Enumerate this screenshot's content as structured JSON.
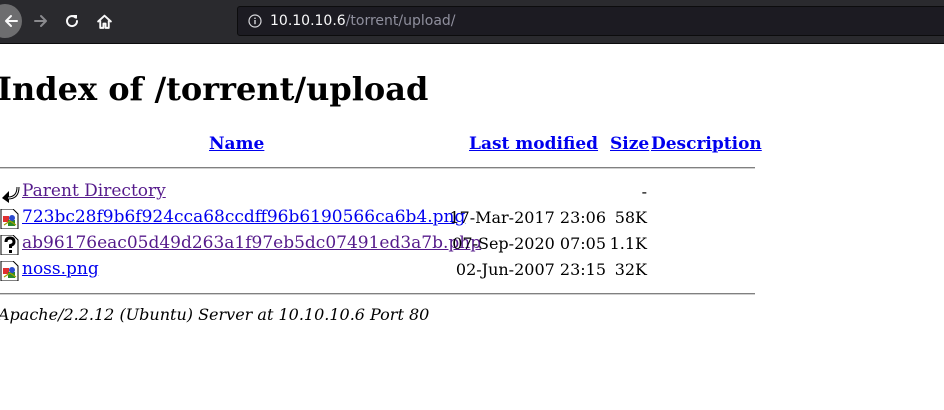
{
  "browser": {
    "url_host": "10.10.10.6",
    "url_path": "/torrent/upload/"
  },
  "page": {
    "title": "Index of /torrent/upload",
    "columns": {
      "name": "Name",
      "last_modified": "Last modified",
      "size": "Size",
      "description": "Description"
    },
    "rows": [
      {
        "icon": "back-arrow-icon",
        "name": "Parent Directory",
        "date": "",
        "size": "-",
        "visited": true
      },
      {
        "icon": "image-file-icon",
        "name": "723bc28f9b6f924cca68ccdff96b6190566ca6b4.png",
        "date": "17-Mar-2017 23:06",
        "size": "58K",
        "visited": false
      },
      {
        "icon": "unknown-file-icon",
        "name": "ab96176eac05d49d263a1f97eb5dc07491ed3a7b.php",
        "date": "07-Sep-2020 07:05",
        "size": "1.1K",
        "visited": true
      },
      {
        "icon": "image-file-icon",
        "name": "noss.png",
        "date": "02-Jun-2007 23:15",
        "size": "32K",
        "visited": false
      }
    ],
    "footer": "Apache/2.2.12 (Ubuntu) Server at 10.10.10.6 Port 80"
  }
}
